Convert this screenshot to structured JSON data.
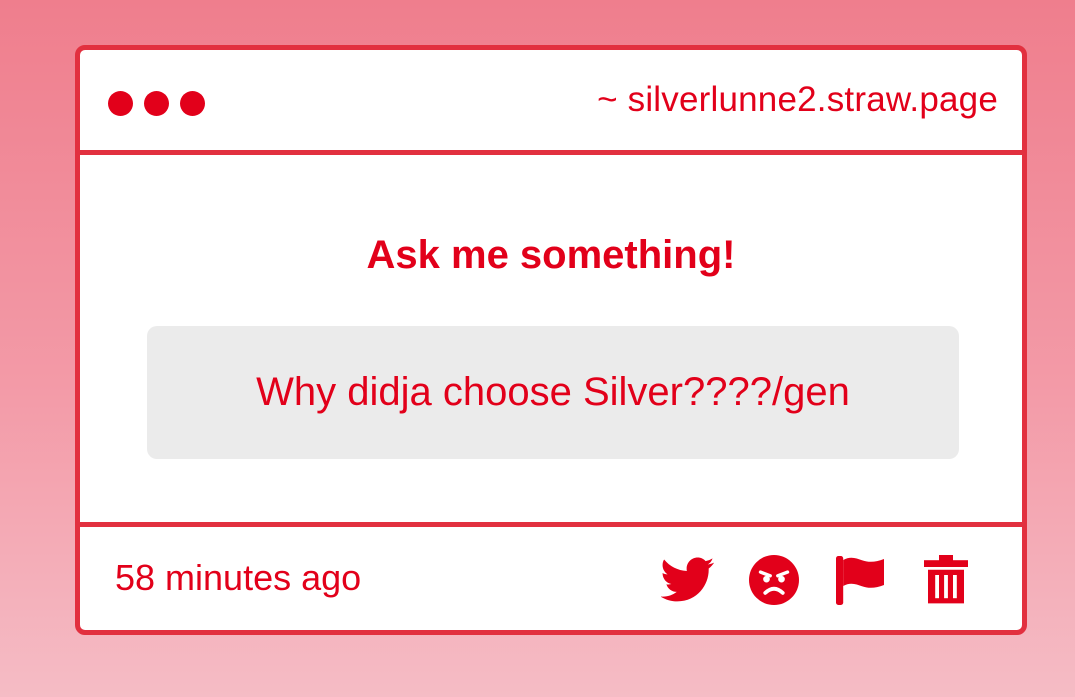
{
  "window": {
    "url": "~ silverlunne2.straw.page"
  },
  "main": {
    "heading": "Ask me something!",
    "question": "Why didja choose Silver????/gen"
  },
  "footer": {
    "timestamp": "58 minutes ago",
    "actions": [
      {
        "icon": "twitter-icon"
      },
      {
        "icon": "angry-face-icon"
      },
      {
        "icon": "flag-icon"
      },
      {
        "icon": "trash-icon"
      }
    ]
  },
  "colors": {
    "accent": "#e2001a",
    "border": "#e2303f",
    "question_bg": "#ebebeb",
    "page_bg_top": "#ef7e8d",
    "page_bg_bottom": "#f5bcc5"
  }
}
